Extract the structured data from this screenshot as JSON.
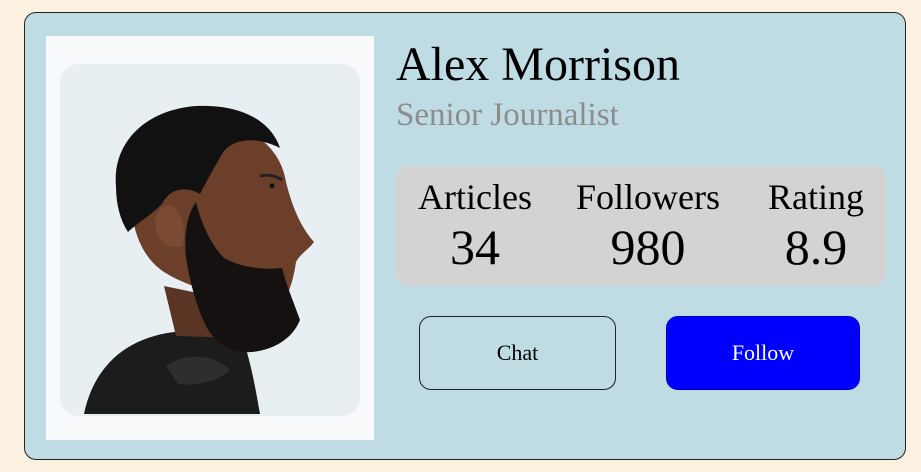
{
  "profile": {
    "name": "Alex Morrison",
    "title": "Senior Journalist"
  },
  "stats": [
    {
      "label": "Articles",
      "value": "34"
    },
    {
      "label": "Followers",
      "value": "980"
    },
    {
      "label": "Rating",
      "value": "8.9"
    }
  ],
  "actions": {
    "chat_label": "Chat",
    "follow_label": "Follow"
  },
  "colors": {
    "page_background": "#fbf1e1",
    "card_background": "#bfdce5",
    "stats_background": "#d3d3d3",
    "subtitle": "#8c8c8c",
    "follow_button": "#0000ff"
  }
}
